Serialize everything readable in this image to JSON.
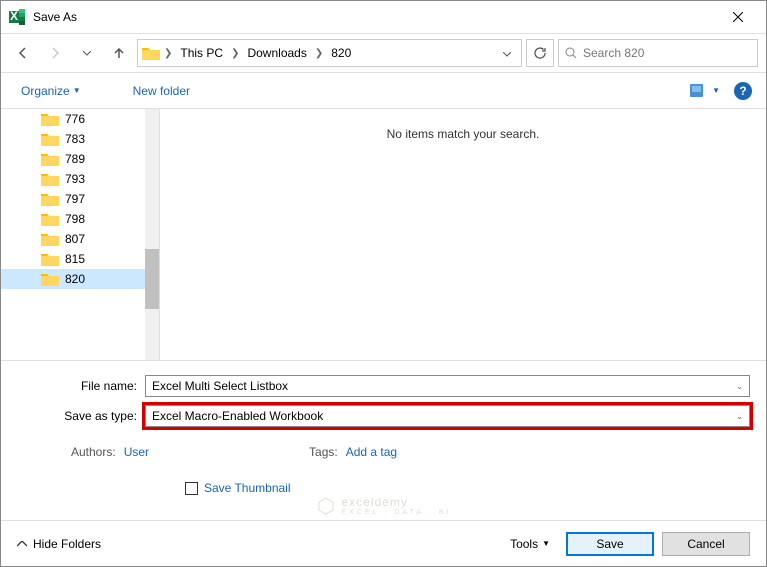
{
  "title": "Save As",
  "breadcrumb": [
    "This PC",
    "Downloads",
    "820"
  ],
  "search_placeholder": "Search 820",
  "toolbar": {
    "organize": "Organize",
    "new_folder": "New folder"
  },
  "tree_items": [
    "776",
    "783",
    "789",
    "793",
    "797",
    "798",
    "807",
    "815",
    "820"
  ],
  "selected_tree_item": "820",
  "main_message": "No items match your search.",
  "form": {
    "filename_label": "File name:",
    "filename_value": "Excel Multi Select Listbox",
    "savetype_label": "Save as type:",
    "savetype_value": "Excel Macro-Enabled Workbook"
  },
  "meta": {
    "authors_label": "Authors:",
    "authors_value": "User",
    "tags_label": "Tags:",
    "tags_value": "Add a tag"
  },
  "thumbnail_label": "Save Thumbnail",
  "footer": {
    "hide_folders": "Hide Folders",
    "tools": "Tools",
    "save": "Save",
    "cancel": "Cancel"
  },
  "watermark": "exceldemy",
  "watermark_sub": "EXCEL · DATA · BI"
}
